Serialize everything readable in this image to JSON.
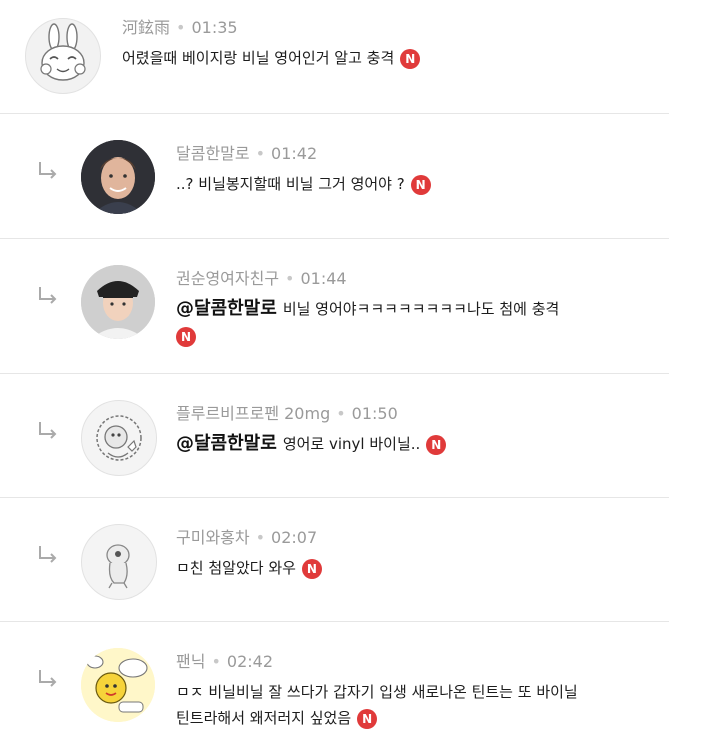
{
  "comments": [
    {
      "author": "河鉉雨",
      "time": "01:35",
      "is_reply": false,
      "mention": "",
      "text": "어렸을때 베이지랑 비닐 영어인거 알고 충격",
      "text2": "",
      "badge": "N",
      "avatar_icon": "rabbit-icon"
    },
    {
      "author": "달콤한말로",
      "time": "01:42",
      "is_reply": true,
      "mention": "",
      "text": "..? 비닐봉지할때 비닐 그거 영어야 ?",
      "text2": "",
      "badge": "N",
      "avatar_icon": "person-photo-icon"
    },
    {
      "author": "권순영여자친구",
      "time": "01:44",
      "is_reply": true,
      "mention": "@달콤한말로",
      "text": "비닐 영어야ㅋㅋㅋㅋㅋㅋㅋㅋ나도 첨에 충격",
      "text2": "",
      "badge": "N",
      "avatar_icon": "person-photo-icon"
    },
    {
      "author": "플루르비프로펜 20mg",
      "time": "01:50",
      "is_reply": true,
      "mention": "@달콤한말로",
      "text": "영어로 vinyl 바이닐..",
      "text2": "",
      "badge": "N",
      "avatar_icon": "character-icon"
    },
    {
      "author": "구미와홍차",
      "time": "02:07",
      "is_reply": true,
      "mention": "",
      "text": "ㅁ친 첨알았다 와우",
      "text2": "",
      "badge": "N",
      "avatar_icon": "character-icon"
    },
    {
      "author": "팬닉",
      "time": "02:42",
      "is_reply": true,
      "mention": "",
      "text": "ㅁㅈ 비닐비닐 잘 쓰다가 갑자기 입생 새로나온 틴트는 또 바이닐",
      "text2": "틴트라해서 왜저러지 싶었음",
      "badge": "N",
      "avatar_icon": "cartoon-icon"
    }
  ],
  "colors": {
    "badge": "#e03a3a",
    "meta": "#9a9a9a",
    "divider": "#e6e6e6"
  }
}
